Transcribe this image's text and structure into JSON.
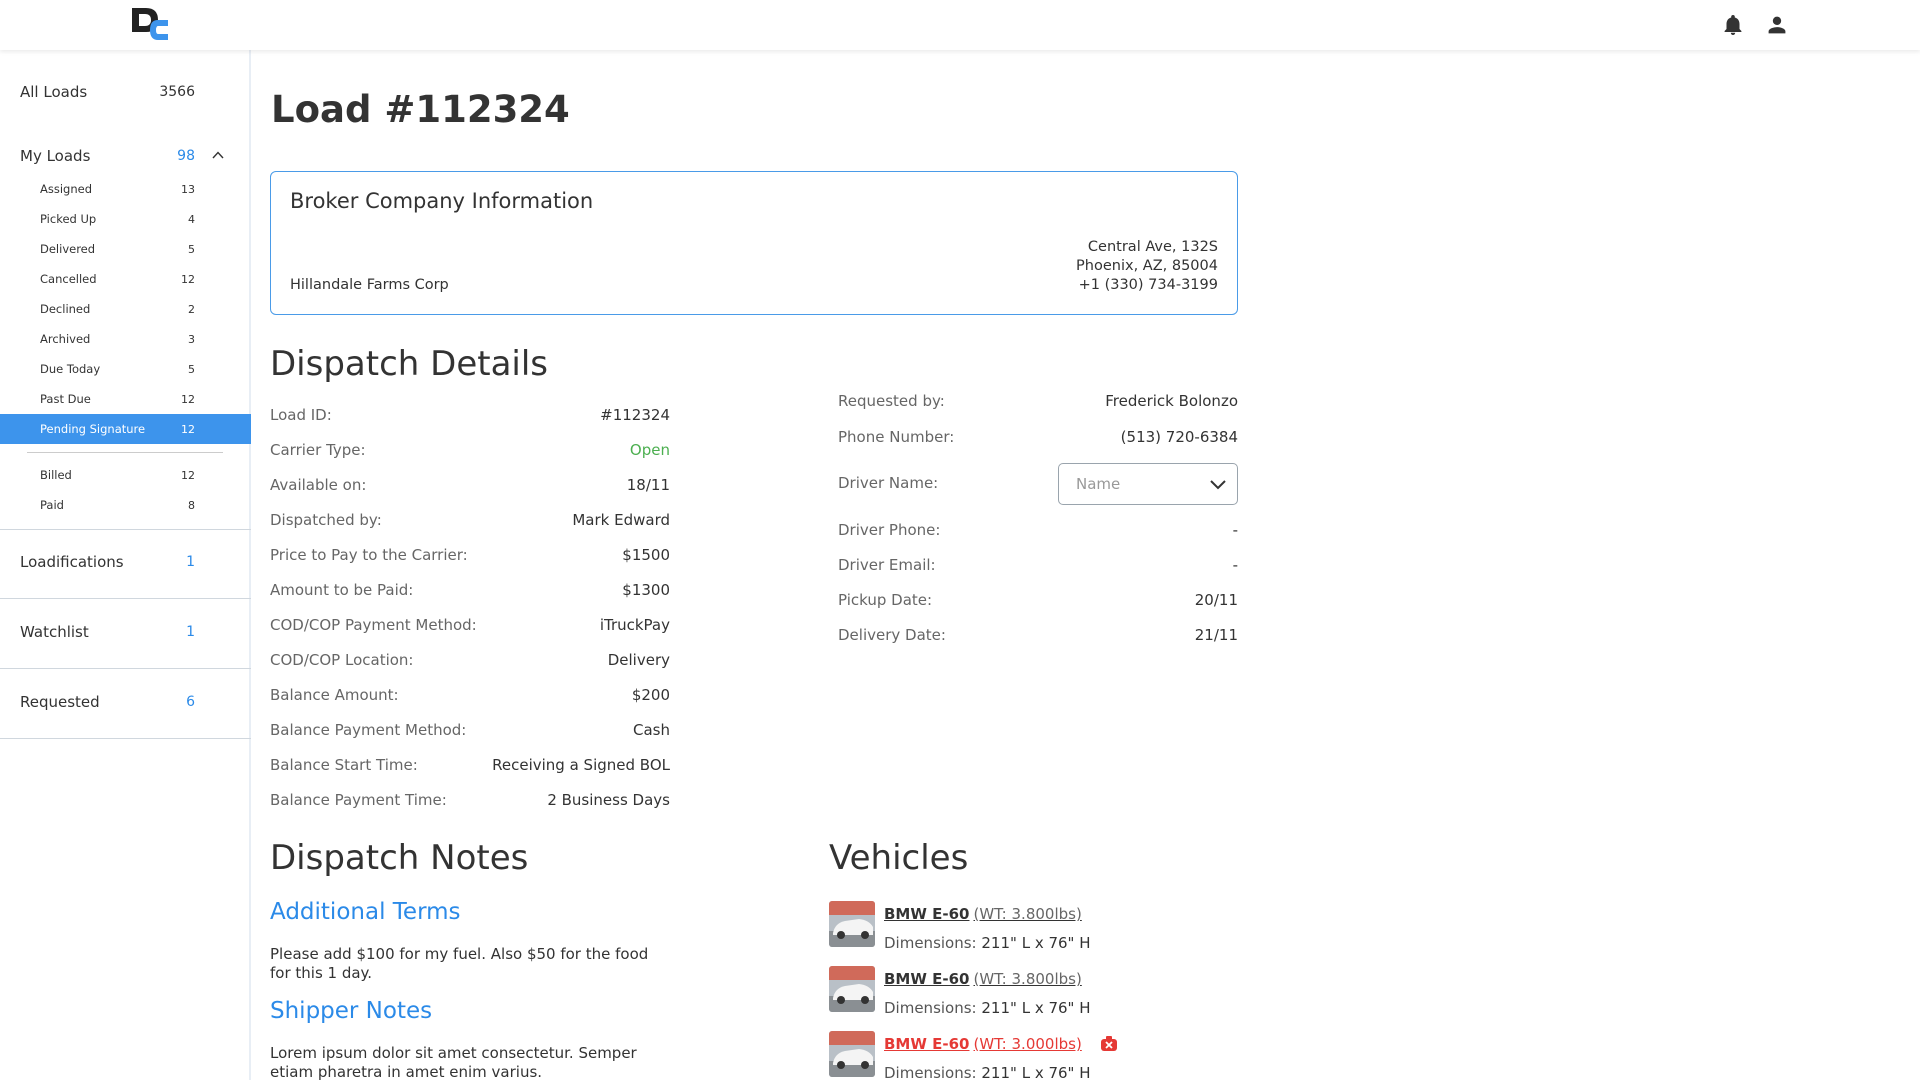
{
  "header": {
    "logo_text": "DC"
  },
  "sidebar": {
    "all_loads": {
      "label": "All Loads",
      "count": "3566"
    },
    "my_loads": {
      "label": "My Loads",
      "count": "98"
    },
    "my_loads_items": [
      {
        "label": "Assigned",
        "count": "13"
      },
      {
        "label": "Picked Up",
        "count": "4"
      },
      {
        "label": "Delivered",
        "count": "5"
      },
      {
        "label": "Cancelled",
        "count": "12"
      },
      {
        "label": "Declined",
        "count": "2"
      },
      {
        "label": "Archived",
        "count": "3"
      },
      {
        "label": "Due Today",
        "count": "5"
      },
      {
        "label": "Past Due",
        "count": "12"
      },
      {
        "label": "Pending Signature",
        "count": "12"
      }
    ],
    "billing_items": [
      {
        "label": "Billed",
        "count": "12"
      },
      {
        "label": "Paid",
        "count": "8"
      }
    ],
    "loadifications": {
      "label": "Loadifications",
      "count": "1"
    },
    "watchlist": {
      "label": "Watchlist",
      "count": "1"
    },
    "requested": {
      "label": "Requested",
      "count": "6"
    }
  },
  "page": {
    "title": "Load #112324"
  },
  "broker": {
    "title": "Broker Company Information",
    "name": "Hillandale Farms Corp",
    "address_line1": "Central Ave, 132S",
    "address_line2": "Phoenix, AZ, 85004",
    "phone": "+1 (330) 734-3199"
  },
  "dispatch": {
    "title": "Dispatch Details",
    "left": [
      {
        "label": "Load ID:",
        "value": "#112324"
      },
      {
        "label": "Carrier Type:",
        "value": "Open"
      },
      {
        "label": "Available on:",
        "value": "18/11"
      },
      {
        "label": "Dispatched by:",
        "value": "Mark Edward"
      },
      {
        "label": "Price to Pay to the Carrier:",
        "value": "$1500"
      },
      {
        "label": "Amount to be Paid:",
        "value": "$1300"
      },
      {
        "label": "COD/COP Payment Method:",
        "value": "iTruckPay"
      },
      {
        "label": "COD/COP Location:",
        "value": "Delivery"
      },
      {
        "label": "Balance Amount:",
        "value": "$200"
      },
      {
        "label": "Balance Payment Method:",
        "value": "Cash"
      },
      {
        "label": "Balance Start Time:",
        "value": "Receiving a Signed BOL"
      },
      {
        "label": "Balance Payment Time:",
        "value": "2 Business Days"
      }
    ],
    "requested_by": {
      "label": "Requested by:",
      "value": "Frederick Bolonzo"
    },
    "phone_number": {
      "label": "Phone Number:",
      "value": "(513) 720-6384"
    },
    "driver_name": {
      "label": "Driver Name:",
      "placeholder": "Name"
    },
    "driver_phone": {
      "label": "Driver Phone:",
      "value": "-"
    },
    "driver_email": {
      "label": "Driver Email:",
      "value": "-"
    },
    "pickup_date": {
      "label": "Pickup Date:",
      "value": "20/11"
    },
    "delivery_date": {
      "label": "Delivery Date:",
      "value": "21/11"
    }
  },
  "notes": {
    "title": "Dispatch Notes",
    "additional_terms_title": "Additional Terms",
    "additional_terms_text": "Please add $100 for my fuel. Also $50 for the food for this 1 day.",
    "shipper_notes_title": "Shipper Notes",
    "shipper_notes_text": "Lorem ipsum dolor sit amet consectetur. Semper etiam pharetra in amet enim varius."
  },
  "vehicles": {
    "title": "Vehicles",
    "items": [
      {
        "name": "BMW E-60",
        "weight": "(WT: 3.800lbs)",
        "dim_label": "Dimensions:",
        "dim_value": "211\" L x 76\" H",
        "warning": false
      },
      {
        "name": "BMW E-60",
        "weight": "(WT: 3.800lbs)",
        "dim_label": "Dimensions:",
        "dim_value": "211\" L x 76\" H",
        "warning": false
      },
      {
        "name": "BMW E-60",
        "weight": "(WT: 3.000lbs)",
        "dim_label": "Dimensions:",
        "dim_value": "211\" L x 76\" H",
        "warning": true
      }
    ]
  },
  "colors": {
    "accent": "#3d94ec",
    "link_blue": "#2b8ae8",
    "success": "#4caf50",
    "danger": "#e53935"
  }
}
